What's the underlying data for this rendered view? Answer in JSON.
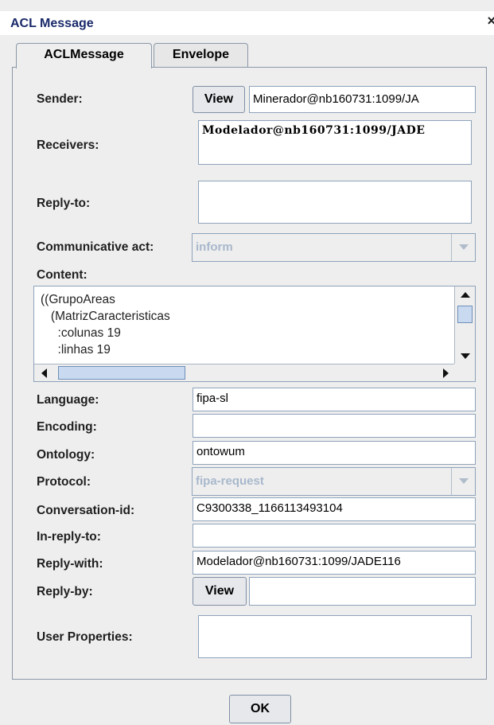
{
  "window": {
    "title": "ACL Message",
    "close_glyph": "×"
  },
  "tabs": [
    {
      "label": "ACLMessage",
      "active": true
    },
    {
      "label": "Envelope",
      "active": false
    }
  ],
  "fields": {
    "sender": {
      "label": "Sender:",
      "button": "View",
      "value": "Minerador@nb160731:1099/JA"
    },
    "receivers": {
      "label": "Receivers:",
      "value": "Modelador@nb160731:1099/JADE"
    },
    "reply_to": {
      "label": "Reply-to:",
      "value": ""
    },
    "communicative_act": {
      "label": "Communicative act:",
      "value": "inform"
    },
    "content": {
      "label": "Content:",
      "lines": [
        "((GrupoAreas",
        "   (MatrizCaracteristicas",
        "     :colunas 19",
        "     :linhas 19"
      ]
    },
    "language": {
      "label": "Language:",
      "value": "fipa-sl"
    },
    "encoding": {
      "label": "Encoding:",
      "value": ""
    },
    "ontology": {
      "label": "Ontology:",
      "value": "ontowum"
    },
    "protocol": {
      "label": "Protocol:",
      "value": "fipa-request"
    },
    "conversation_id": {
      "label": "Conversation-id:",
      "value": "C9300338_1166113493104"
    },
    "in_reply_to": {
      "label": "In-reply-to:",
      "value": ""
    },
    "reply_with": {
      "label": "Reply-with:",
      "value": "Modelador@nb160731:1099/JADE116"
    },
    "reply_by": {
      "label": "Reply-by:",
      "button": "View",
      "value": ""
    },
    "user_properties": {
      "label": "User Properties:",
      "value": ""
    }
  },
  "footer": {
    "ok_label": "OK"
  },
  "icons": {
    "close": "close-icon",
    "up": "arrow-up-icon",
    "down": "arrow-down-icon",
    "left": "arrow-left-icon",
    "right": "arrow-right-icon",
    "combo": "chevron-down-icon"
  },
  "colors": {
    "title_text": "#1a2a6a",
    "field_border": "#8ea3bb",
    "disabled_text": "#a8b8cc",
    "scroll_thumb": "#c9daf0"
  }
}
